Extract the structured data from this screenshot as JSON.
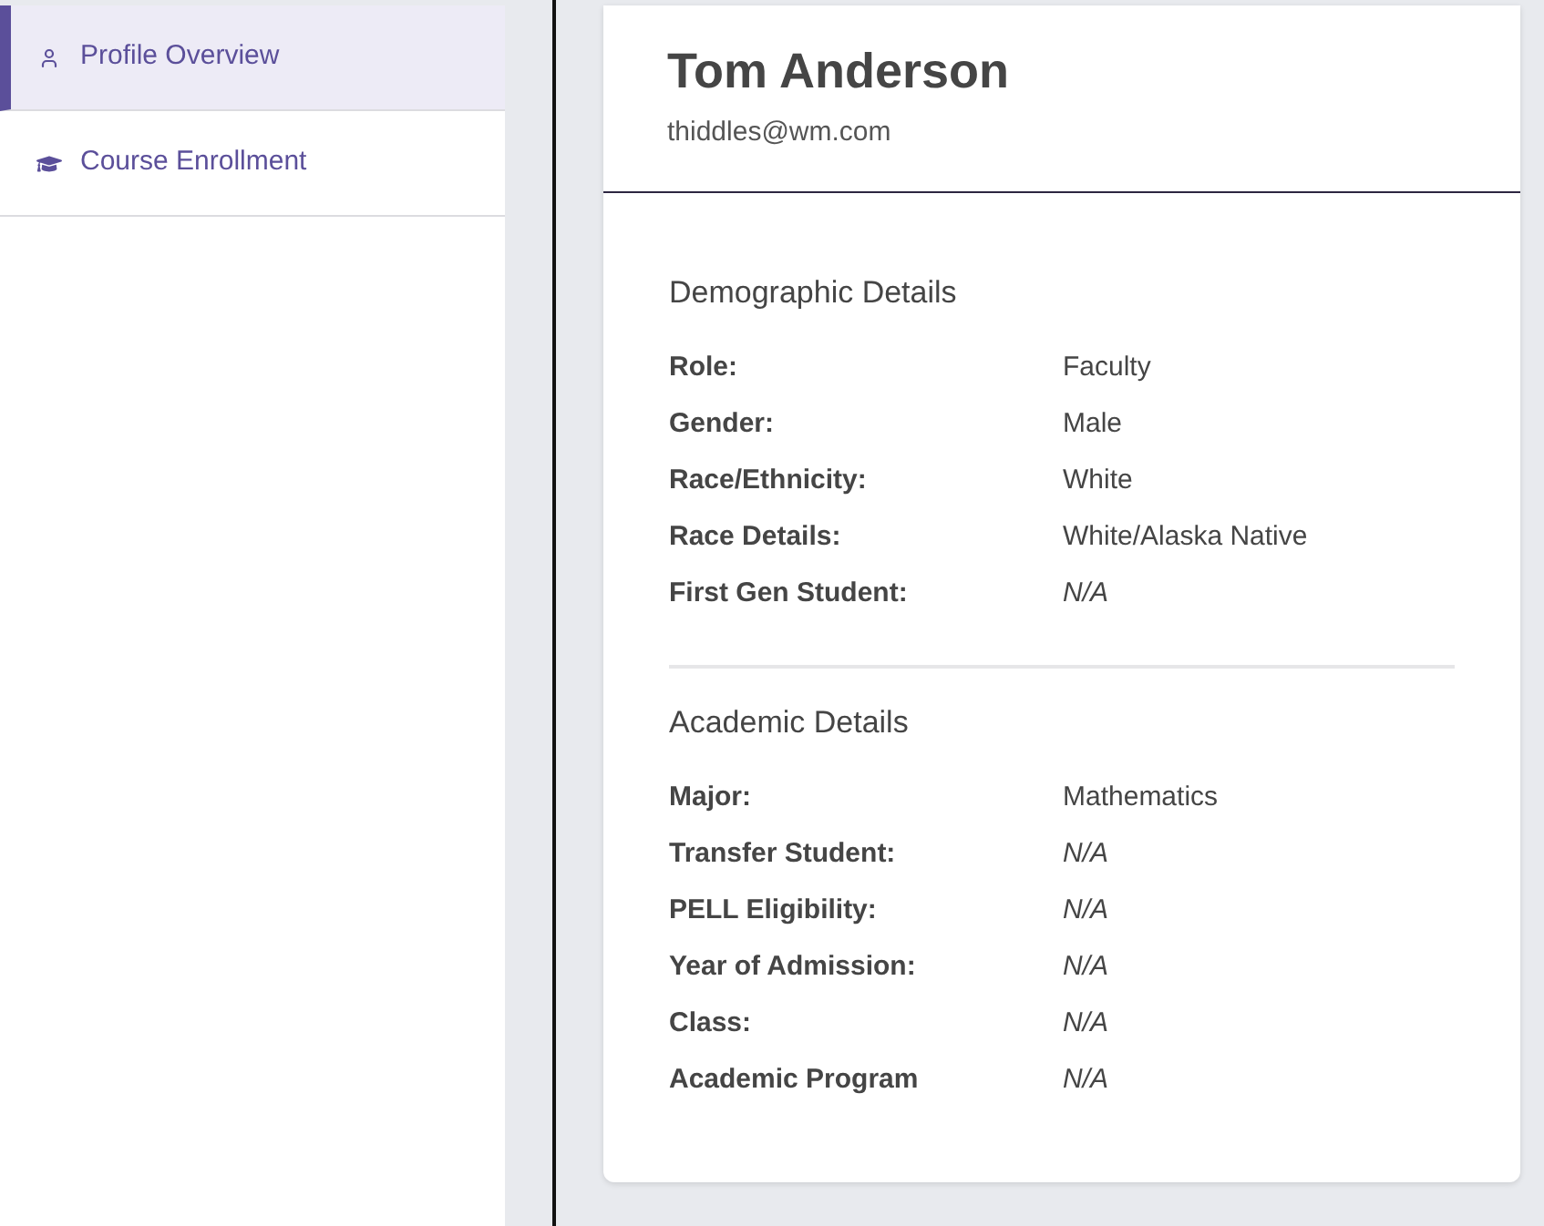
{
  "sidebar": {
    "items": [
      {
        "label": "Profile Overview",
        "selected": true
      },
      {
        "label": "Course Enrollment",
        "selected": false
      }
    ]
  },
  "profile": {
    "name": "Tom Anderson",
    "email": "thiddles@wm.com"
  },
  "sections": [
    {
      "title": "Demographic Details",
      "fields": [
        {
          "label": "Role:",
          "value": "Faculty",
          "missing": false
        },
        {
          "label": "Gender:",
          "value": "Male",
          "missing": false
        },
        {
          "label": "Race/Ethnicity:",
          "value": "White",
          "missing": false
        },
        {
          "label": "Race Details:",
          "value": "White/Alaska Native",
          "missing": false
        },
        {
          "label": "First Gen Student:",
          "value": "N/A",
          "missing": true
        }
      ]
    },
    {
      "title": "Academic Details",
      "fields": [
        {
          "label": "Major:",
          "value": "Mathematics",
          "missing": false
        },
        {
          "label": "Transfer Student:",
          "value": "N/A",
          "missing": true
        },
        {
          "label": "PELL Eligibility:",
          "value": "N/A",
          "missing": true
        },
        {
          "label": "Year of Admission:",
          "value": "N/A",
          "missing": true
        },
        {
          "label": "Class:",
          "value": "N/A",
          "missing": true
        },
        {
          "label": "Academic Program",
          "value": "N/A",
          "missing": true
        }
      ]
    }
  ]
}
